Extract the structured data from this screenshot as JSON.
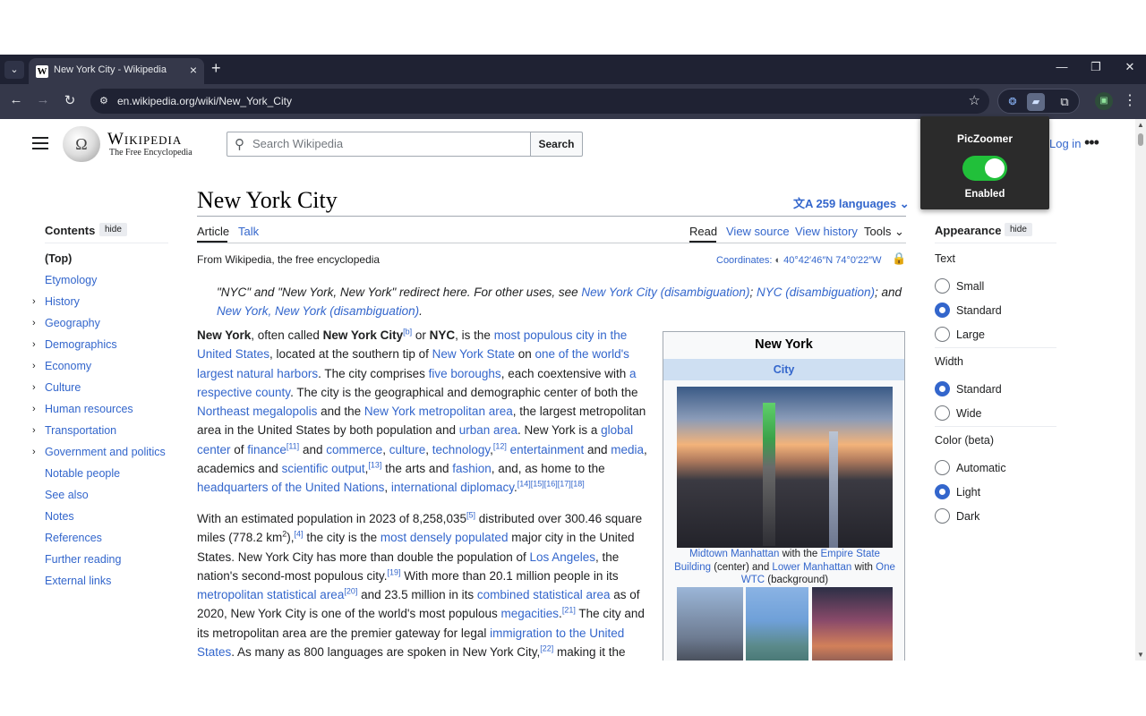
{
  "browser": {
    "tab_title": "New York City - Wikipedia",
    "url": "en.wikipedia.org/wiki/New_York_City",
    "favicon_letter": "W",
    "icons": [
      "chevron-down-icon",
      "close-icon",
      "plus-icon",
      "minimize-icon",
      "maximize-icon",
      "back-icon",
      "forward-icon",
      "reload-icon",
      "site-info-icon",
      "star-icon",
      "extension-icon",
      "puzzle-icon",
      "profile-icon",
      "menu-icon"
    ]
  },
  "header": {
    "wordmark": "Wikipedia",
    "tagline": "The Free Encyclopedia",
    "search_placeholder": "Search Wikipedia",
    "search_button": "Search",
    "login": "Log in",
    "more": "•••"
  },
  "article": {
    "title": "New York City",
    "languages": "259 languages",
    "tabs": {
      "article": "Article",
      "talk": "Talk",
      "read": "Read",
      "view_source": "View source",
      "view_history": "View history",
      "tools": "Tools"
    },
    "from": "From Wikipedia, the free encyclopedia",
    "coordinates_label": "Coordinates:",
    "coordinates_value": "40°42′46″N 74°0′22″W"
  },
  "toc": {
    "title": "Contents",
    "hide": "hide",
    "items": [
      {
        "label": "(Top)",
        "expandable": false
      },
      {
        "label": "Etymology",
        "expandable": false
      },
      {
        "label": "History",
        "expandable": true
      },
      {
        "label": "Geography",
        "expandable": true
      },
      {
        "label": "Demographics",
        "expandable": true
      },
      {
        "label": "Economy",
        "expandable": true
      },
      {
        "label": "Culture",
        "expandable": true
      },
      {
        "label": "Human resources",
        "expandable": true
      },
      {
        "label": "Transportation",
        "expandable": true
      },
      {
        "label": "Government and politics",
        "expandable": true
      },
      {
        "label": "Notable people",
        "expandable": false
      },
      {
        "label": "See also",
        "expandable": false
      },
      {
        "label": "Notes",
        "expandable": false
      },
      {
        "label": "References",
        "expandable": false
      },
      {
        "label": "Further reading",
        "expandable": false
      },
      {
        "label": "External links",
        "expandable": false
      }
    ]
  },
  "infobox": {
    "title": "New York",
    "subtitle": "City",
    "caption": {
      "a": "Midtown Manhattan",
      "b": " with the ",
      "c": "Empire State Building",
      "d": " (center) and ",
      "e": "Lower Manhattan",
      "f": " with ",
      "g": "One WTC",
      "h": " (background)"
    }
  },
  "appearance": {
    "title": "Appearance",
    "hide": "hide",
    "text_label": "Text",
    "text_options": [
      {
        "label": "Small",
        "selected": false
      },
      {
        "label": "Standard",
        "selected": true
      },
      {
        "label": "Large",
        "selected": false
      }
    ],
    "width_label": "Width",
    "width_options": [
      {
        "label": "Standard",
        "selected": true
      },
      {
        "label": "Wide",
        "selected": false
      }
    ],
    "color_label": "Color (beta)",
    "color_options": [
      {
        "label": "Automatic",
        "selected": false
      },
      {
        "label": "Light",
        "selected": true
      },
      {
        "label": "Dark",
        "selected": false
      }
    ]
  },
  "popup": {
    "title": "PicZoomer",
    "status": "Enabled",
    "enabled": true
  },
  "colors": {
    "link": "#3366cc",
    "chrome_dark": "#1f2233",
    "toggle_on": "#21c03a"
  }
}
